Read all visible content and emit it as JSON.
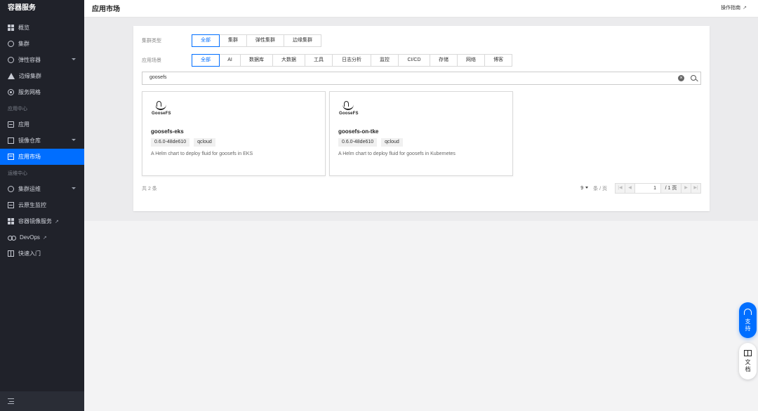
{
  "sidebar": {
    "title": "容器服务",
    "items": [
      {
        "label": "概览",
        "icon": "dashboard-icon"
      },
      {
        "label": "集群",
        "icon": "cluster-icon"
      },
      {
        "label": "弹性容器",
        "icon": "elastic-container-icon",
        "expandable": true
      },
      {
        "label": "边缘集群",
        "icon": "edge-cluster-icon"
      },
      {
        "label": "服务网格",
        "icon": "service-mesh-icon"
      }
    ],
    "section_app": "应用中心",
    "app_items": [
      {
        "label": "应用",
        "icon": "app-icon"
      },
      {
        "label": "镜像仓库",
        "icon": "image-registry-icon",
        "expandable": true
      },
      {
        "label": "应用市场",
        "icon": "app-market-icon",
        "active": true
      }
    ],
    "section_ops": "运维中心",
    "ops_items": [
      {
        "label": "集群运维",
        "icon": "cluster-ops-icon",
        "expandable": true
      },
      {
        "label": "云原生监控",
        "icon": "monitor-icon"
      },
      {
        "label": "容器镜像服务",
        "icon": "image-service-icon",
        "external": true
      },
      {
        "label": "DevOps",
        "icon": "devops-icon",
        "external": true
      },
      {
        "label": "快速入门",
        "icon": "quickstart-icon"
      }
    ]
  },
  "header": {
    "title": "应用市场",
    "guide": "操作指南"
  },
  "filters": {
    "cluster_type_label": "集群类型",
    "cluster_types": [
      "全部",
      "集群",
      "弹性集群",
      "边缘集群"
    ],
    "scene_label": "应用场景",
    "scenes": [
      "全部",
      "AI",
      "数据库",
      "大数据",
      "工具",
      "日志分析",
      "监控",
      "CI/CD",
      "存储",
      "网络",
      "博客"
    ]
  },
  "search": {
    "value": "goosefs"
  },
  "cards": [
    {
      "logo_text": "GooseFS",
      "name": "goosefs-eks",
      "version": "0.6.0-48de610",
      "source": "qcloud",
      "desc": "A Helm chart to deploy fluid for goosefs in EKS"
    },
    {
      "logo_text": "GooseFS",
      "name": "goosefs-on-tke",
      "version": "0.6.0-48de610",
      "source": "qcloud",
      "desc": "A Helm chart to deploy fluid for goosefs in Kubernetes"
    }
  ],
  "pagination": {
    "total_text": "共 2 条",
    "page_size": "9",
    "unit": "条 / 页",
    "current_page": "1",
    "total_pages": "/ 1 页"
  },
  "floating": {
    "support": "支持",
    "docs": "文档"
  },
  "colors": {
    "accent": "#006eff",
    "sidebar_bg": "#20222a"
  }
}
